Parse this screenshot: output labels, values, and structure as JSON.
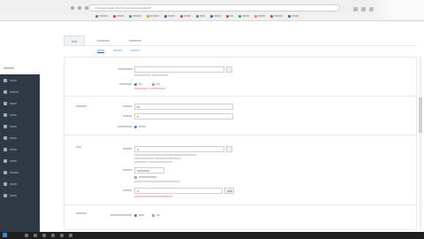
{
  "browser": {
    "url": "...cn/xxxxxxx/index.php?s=/xxxxx/xxxx/goods/edit",
    "bookmarks": [
      {
        "label": "XXXXX",
        "color": "#3b82c4"
      },
      {
        "label": "XXXX",
        "color": "#d94b3f"
      },
      {
        "label": "XXXXX",
        "color": "#3aa757"
      },
      {
        "label": "XXXXX",
        "color": "#e59b2b"
      },
      {
        "label": "XXXX",
        "color": "#2d6fc8"
      },
      {
        "label": "XXXX",
        "color": "#d94b3f"
      },
      {
        "label": "XXX",
        "color": "#3aa757"
      },
      {
        "label": "XXXX",
        "color": "#2d6fc8"
      },
      {
        "label": "XX",
        "color": "#d94b3f"
      },
      {
        "label": "XXXX",
        "color": "#3aa757"
      },
      {
        "label": "XXXX",
        "color": "#e59b2b"
      },
      {
        "label": "XXXXX",
        "color": "#d94b3f"
      },
      {
        "label": "XXXX",
        "color": "#2d6fc8"
      }
    ]
  },
  "sidebar": {
    "brand": "XXXXXX",
    "items": [
      {
        "label": "XXXX",
        "icon": "order-icon"
      },
      {
        "label": "XXXXX",
        "icon": "user-icon"
      },
      {
        "label": "XXXX",
        "icon": "store-icon"
      },
      {
        "label": "XXXX",
        "icon": "goods-icon"
      },
      {
        "label": "XXXX",
        "icon": "marketing-icon"
      },
      {
        "label": "XXXX",
        "icon": "finance-icon"
      },
      {
        "label": "XXXX",
        "icon": "data-icon"
      },
      {
        "label": "XXXX",
        "icon": "content-icon"
      },
      {
        "label": "XXXXX",
        "icon": "plugin-icon"
      },
      {
        "label": "XXXX",
        "icon": "system-icon"
      },
      {
        "label": "XXXX",
        "icon": "setting-icon"
      }
    ]
  },
  "tabs": [
    "XXX",
    "XXXXXXX",
    "XXXXXXX"
  ],
  "subtabs": [
    "XXXX",
    "XXXXX",
    "XXXXX"
  ],
  "form": {
    "top_field_label": "XXXXXXXX",
    "top_hint": "XXXXXXXXXXX, XXXXXXXXXXX",
    "show_label": "XXXXXXX:",
    "show_options": [
      "XX",
      "XX"
    ],
    "show_hint_red": "XXXXXXXXX, XXXXXXXXXXX",
    "section_stock": "XXXXXX",
    "stock_label": "XXXXX:",
    "stock_value": "10",
    "warn_label": "XXXXX:",
    "warn_value": "0",
    "deduct_label": "XXXXXXXX:",
    "deduct_options": [
      "XXXX"
    ],
    "section_price": "XXX",
    "price_label": "XXXXX:",
    "price_value": "0",
    "price_hint": "XXXXXXXXXXXXXXXXXXXXXXXXXXXXXXXXXXXXXXXXXX",
    "price_hint2": "XXXXXXXXXXXXX, XXXXXXXXXXXXXXXXXX",
    "price_hint3": "XXXXXXXXX, XXXXXXXXXXXXXXXX",
    "cost_label": "XXXXX:",
    "cost_value": "XXXXXXX",
    "cost_option": "XXXXXXXXXX",
    "cost_hint": "XXXXXXXXXXXXXXXXXXXXXXXXXXXXXXX",
    "template_label": "XXXXX:",
    "template_value": "X",
    "template_btn": "XXX",
    "template_hint_red": "XXXXXXXXXXXXXXXXXXXXXXXXXX",
    "section_other": "XXXXXX",
    "other_label": "XXXXXXXXXXXX:",
    "other_options": [
      "XXX",
      "XX"
    ]
  }
}
